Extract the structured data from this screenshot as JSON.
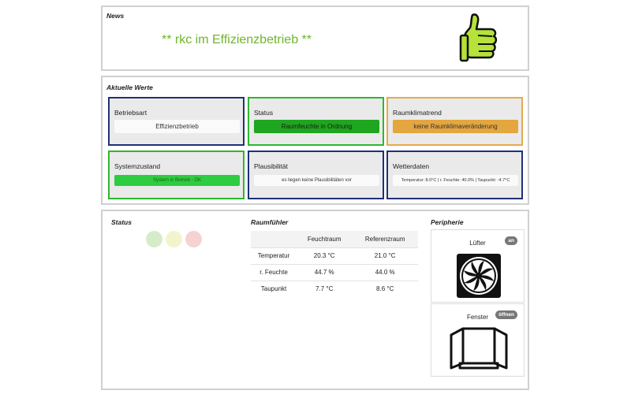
{
  "news": {
    "title": "News",
    "message": "** rkc im Effizienzbetrieb **",
    "icon": "thumbs-up-icon"
  },
  "current_values": {
    "title": "Aktuelle Werte",
    "tiles": [
      {
        "label": "Betriebsart",
        "value": "Effizienzbetrieb",
        "state": "neutral"
      },
      {
        "label": "Status",
        "value": "Raumfeuchte in Ordnung",
        "state": "ok"
      },
      {
        "label": "Raumklimatrend",
        "value": "keine Raumklimaveränderung",
        "state": "warning"
      },
      {
        "label": "Systemzustand",
        "value": "System in Betrieb - OK",
        "state": "ok"
      },
      {
        "label": "Plausibilität",
        "value": "es liegen keine Plausibilitäten vor",
        "state": "neutral"
      },
      {
        "label": "Wetterdaten",
        "value": "Temperatur: 8.0°C | r. Feuchte: 40.0% | Taupunkt: -4.7°C",
        "state": "neutral"
      }
    ]
  },
  "status": {
    "title": "Status",
    "lights": [
      {
        "color": "#d6ecc8",
        "name": "green"
      },
      {
        "color": "#f4f4cc",
        "name": "yellow"
      },
      {
        "color": "#f6d2d2",
        "name": "red"
      }
    ]
  },
  "sensors": {
    "title": "Raumfühler",
    "columns": [
      "",
      "Feuchtraum",
      "Referenzraum"
    ],
    "rows": [
      [
        "Temperatur",
        "20.3 °C",
        "21.0 °C"
      ],
      [
        "r. Feuchte",
        "44.7 %",
        "44.0 %"
      ],
      [
        "Taupunkt",
        "7.7 °C",
        "8.6 °C"
      ]
    ]
  },
  "periphery": {
    "title": "Peripherie",
    "devices": [
      {
        "label": "Lüfter",
        "badge": "an",
        "icon": "fan-icon"
      },
      {
        "label": "Fenster",
        "badge": "öffnen",
        "icon": "window-icon"
      }
    ]
  },
  "colors": {
    "accent_green": "#6fb52c",
    "tile_border_blue": "#20307a",
    "tile_border_green": "#2db82d",
    "tile_border_orange": "#e8a94a"
  }
}
